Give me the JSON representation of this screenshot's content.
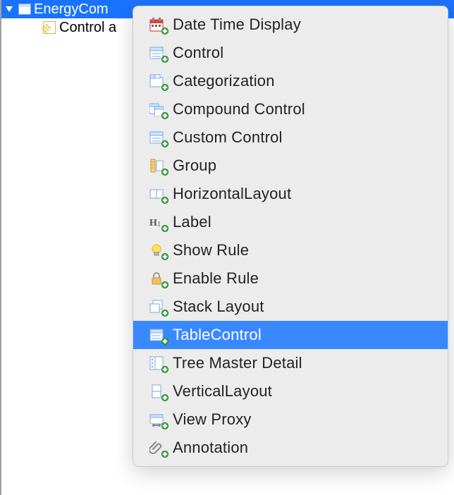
{
  "tree": {
    "root": {
      "label": "EnergyCom",
      "expanded": true,
      "selected": true
    },
    "children": [
      {
        "label": "Control a"
      }
    ]
  },
  "context_menu": {
    "highlighted_index": 11,
    "items": [
      {
        "icon": "date-time-display-icon",
        "label": "Date Time Display"
      },
      {
        "icon": "control-icon",
        "label": "Control"
      },
      {
        "icon": "categorization-icon",
        "label": "Categorization"
      },
      {
        "icon": "compound-control-icon",
        "label": "Compound Control"
      },
      {
        "icon": "custom-control-icon",
        "label": "Custom Control"
      },
      {
        "icon": "group-icon",
        "label": "Group"
      },
      {
        "icon": "horizontal-layout-icon",
        "label": "HorizontalLayout"
      },
      {
        "icon": "label-icon",
        "label": "Label"
      },
      {
        "icon": "show-rule-icon",
        "label": "Show Rule"
      },
      {
        "icon": "enable-rule-icon",
        "label": "Enable Rule"
      },
      {
        "icon": "stack-layout-icon",
        "label": "Stack Layout"
      },
      {
        "icon": "table-control-icon",
        "label": "TableControl"
      },
      {
        "icon": "tree-master-detail-icon",
        "label": "Tree Master Detail"
      },
      {
        "icon": "vertical-layout-icon",
        "label": "VerticalLayout"
      },
      {
        "icon": "view-proxy-icon",
        "label": "View Proxy"
      },
      {
        "icon": "annotation-icon",
        "label": "Annotation"
      }
    ]
  },
  "colors": {
    "selection": "#1a73ff",
    "menu_highlight": "#3a88ff",
    "menu_bg": "#ececec"
  }
}
